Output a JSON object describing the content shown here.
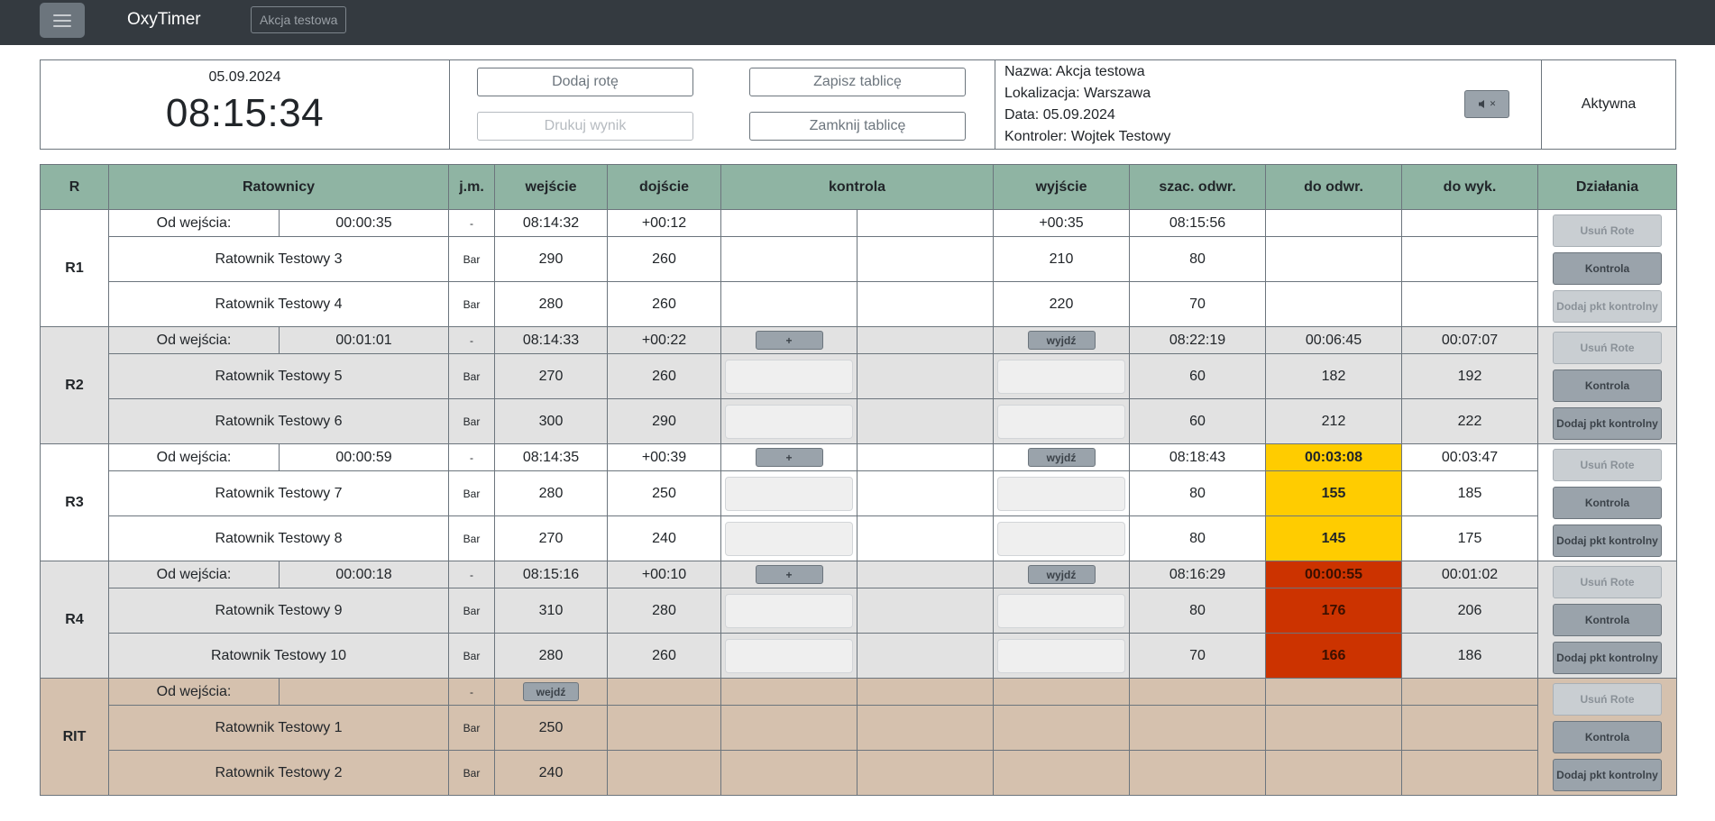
{
  "nav": {
    "brand": "OxyTimer",
    "action_chip": "Akcja testowa"
  },
  "clock": {
    "date": "05.09.2024",
    "time": "08:15:34"
  },
  "buttons": {
    "add_rota": "Dodaj rotę",
    "print_result": "Drukuj wynik",
    "save_board": "Zapisz tablicę",
    "close_board": "Zamknij tablicę"
  },
  "info": {
    "name": "Nazwa: Akcja testowa",
    "location": "Lokalizacja: Warszawa",
    "date": "Data: 05.09.2024",
    "controller": "Kontroler: Wojtek Testowy",
    "mute_icon": "✕"
  },
  "status": "Aktywna",
  "table": {
    "headers": {
      "r": "R",
      "rescuers": "Ratownicy",
      "unit": "j.m.",
      "entry": "wejście",
      "arrival": "dojście",
      "control": "kontrola",
      "exit": "wyjście",
      "est_withdraw": "szac. odwr.",
      "to_withdraw": "do odwr.",
      "to_exit": "do wyk.",
      "actions": "Działania"
    },
    "since_entry_label": "Od wejścia:",
    "dash": "-",
    "unit": "Bar",
    "btn_plus": "+",
    "btn_exit": "wyjdź",
    "btn_enter": "wejdź",
    "act_remove": "Usuń Rote",
    "act_control": "Kontrola",
    "act_add_checkpoint": "Dodaj pkt kontrolny",
    "rotas": [
      {
        "label": "R1",
        "elapsed": "00:00:35",
        "entry": "08:14:32",
        "arrival": "+00:12",
        "exit": "+00:35",
        "est": "08:15:56",
        "to_withdraw": "",
        "to_exit": "",
        "members": [
          {
            "name": "Ratownik Testowy 3",
            "entry": "290",
            "arrival": "260",
            "exit": "210",
            "est": "80",
            "to_withdraw": "",
            "to_exit": ""
          },
          {
            "name": "Ratownik Testowy 4",
            "entry": "280",
            "arrival": "260",
            "exit": "220",
            "est": "70",
            "to_withdraw": "",
            "to_exit": ""
          }
        ]
      },
      {
        "label": "R2",
        "elapsed": "00:01:01",
        "entry": "08:14:33",
        "arrival": "+00:22",
        "est": "08:22:19",
        "to_withdraw": "00:06:45",
        "to_exit": "00:07:07",
        "members": [
          {
            "name": "Ratownik Testowy 5",
            "entry": "270",
            "arrival": "260",
            "est": "60",
            "to_withdraw": "182",
            "to_exit": "192"
          },
          {
            "name": "Ratownik Testowy 6",
            "entry": "300",
            "arrival": "290",
            "est": "60",
            "to_withdraw": "212",
            "to_exit": "222"
          }
        ]
      },
      {
        "label": "R3",
        "elapsed": "00:00:59",
        "entry": "08:14:35",
        "arrival": "+00:39",
        "est": "08:18:43",
        "to_withdraw": "00:03:08",
        "to_exit": "00:03:47",
        "members": [
          {
            "name": "Ratownik Testowy 7",
            "entry": "280",
            "arrival": "250",
            "est": "80",
            "to_withdraw": "155",
            "to_exit": "185"
          },
          {
            "name": "Ratownik Testowy 8",
            "entry": "270",
            "arrival": "240",
            "est": "80",
            "to_withdraw": "145",
            "to_exit": "175"
          }
        ]
      },
      {
        "label": "R4",
        "elapsed": "00:00:18",
        "entry": "08:15:16",
        "arrival": "+00:10",
        "est": "08:16:29",
        "to_withdraw": "00:00:55",
        "to_exit": "00:01:02",
        "members": [
          {
            "name": "Ratownik Testowy 9",
            "entry": "310",
            "arrival": "280",
            "est": "80",
            "to_withdraw": "176",
            "to_exit": "206"
          },
          {
            "name": "Ratownik Testowy 10",
            "entry": "280",
            "arrival": "260",
            "est": "70",
            "to_withdraw": "166",
            "to_exit": "186"
          }
        ]
      },
      {
        "label": "RIT",
        "members": [
          {
            "name": "Ratownik Testowy 1",
            "entry": "250"
          },
          {
            "name": "Ratownik Testowy 2",
            "entry": "240"
          }
        ]
      }
    ]
  },
  "colors": {
    "navbar": "#343a40",
    "header_green": "#8fb4a3",
    "row_grey": "#e2e2e2",
    "row_tan": "#d5c1ae",
    "warn_yellow": "#ffcc00",
    "warn_red": "#cc3300"
  }
}
